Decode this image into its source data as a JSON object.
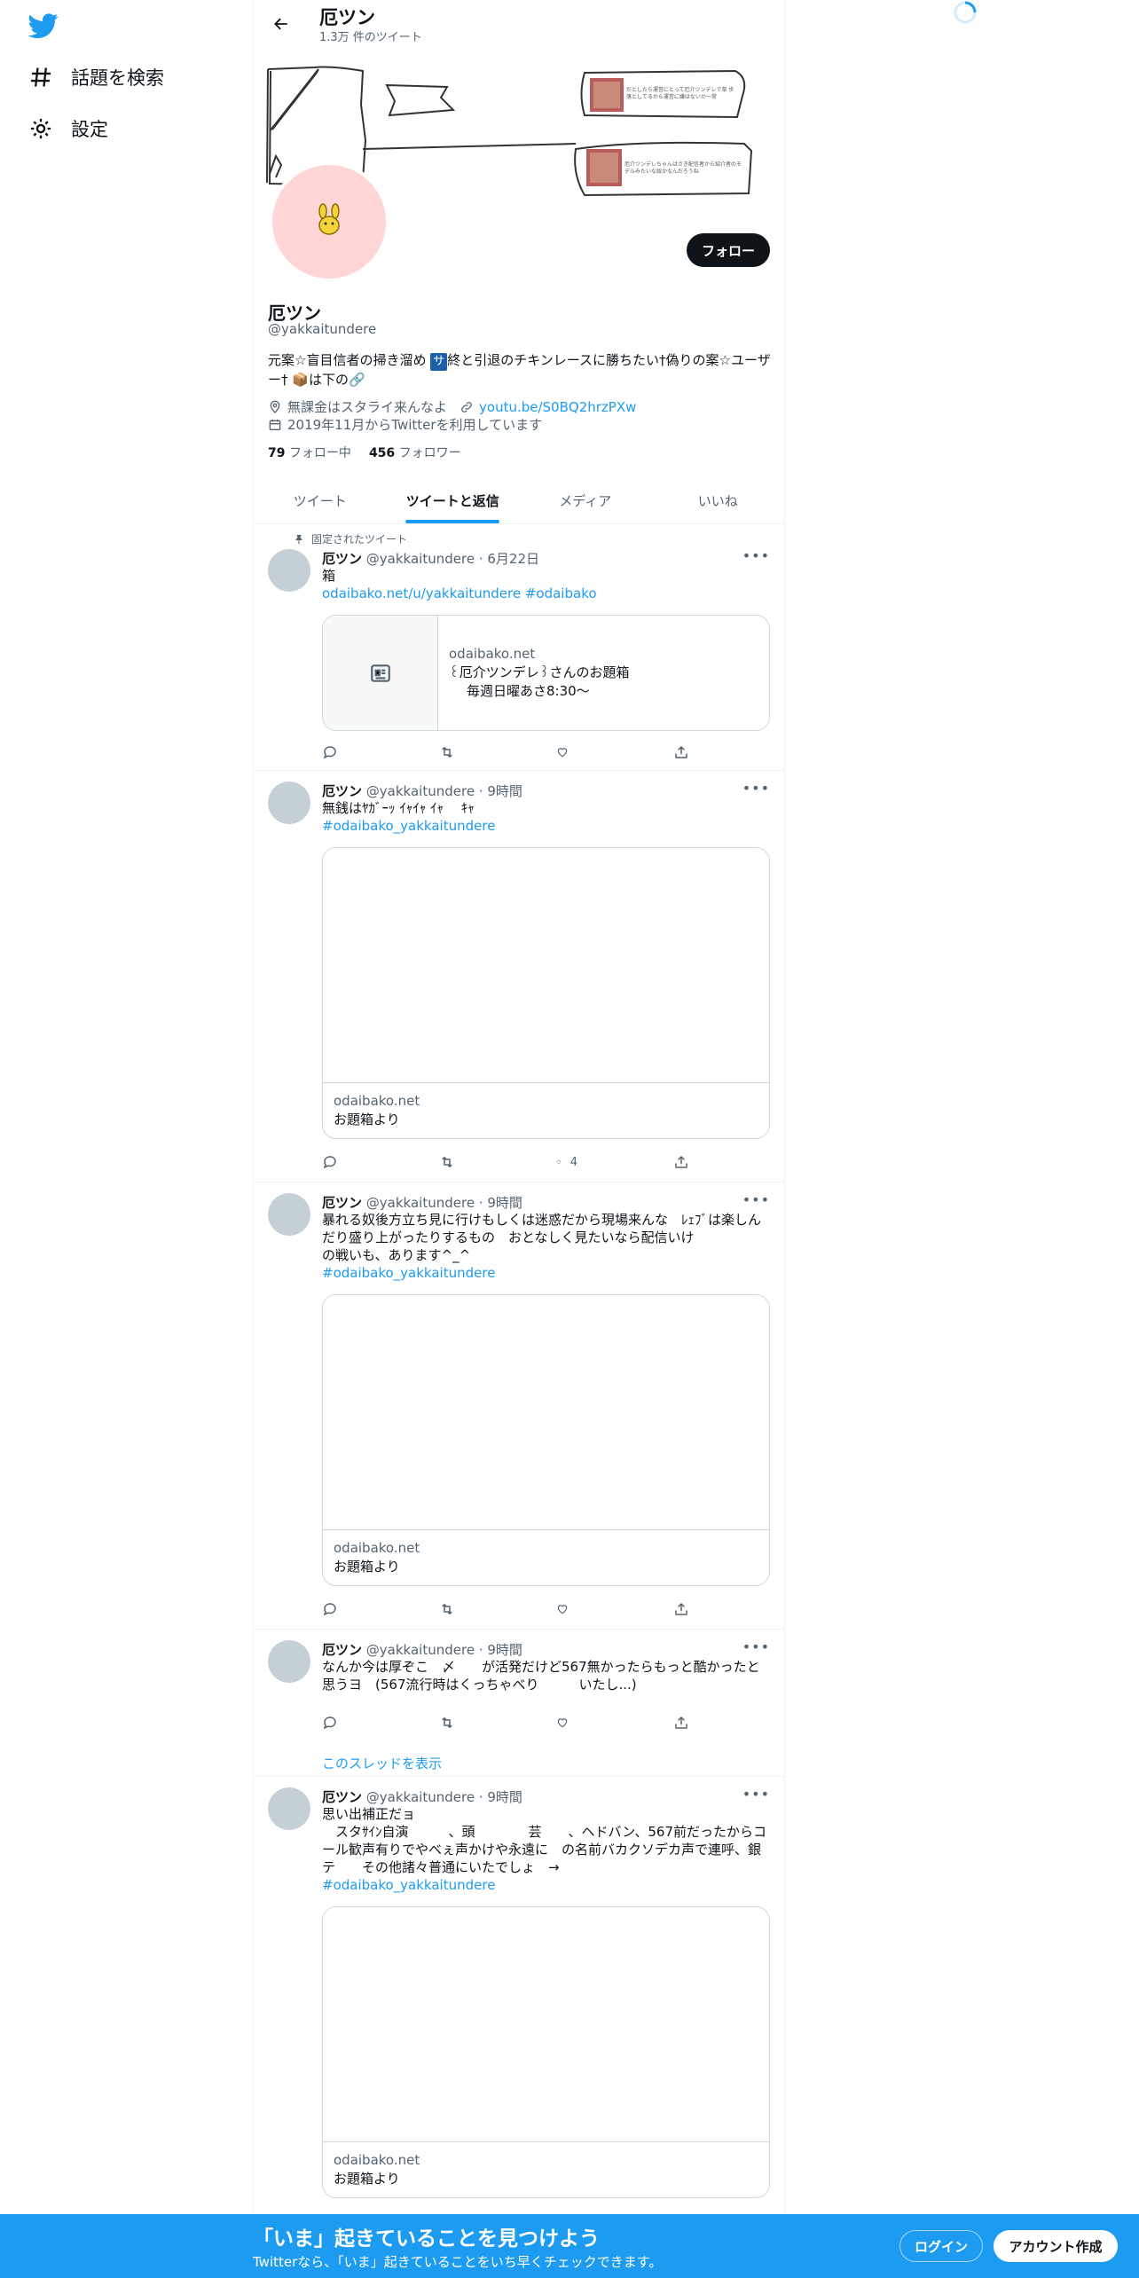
{
  "colors": {
    "accent": "#1d9bf0",
    "text": "#0f1419",
    "muted": "#536471",
    "border": "#eff3f4",
    "avatar_bg": "#ffd5d5"
  },
  "sidebar": {
    "logo_icon": "twitter-bird-icon",
    "items": [
      {
        "label": "話題を検索",
        "icon": "hashtag-icon"
      },
      {
        "label": "設定",
        "icon": "gear-icon"
      }
    ]
  },
  "header": {
    "title": "厄ツン",
    "subtitle": "1.3万 件のツイート"
  },
  "banner": {
    "note1": "だとしたら運営にとって厄介ツンデレで草 歩落としてるから運営に嫌はないか一常",
    "note2": "厄介ツンデレちゃんはさき配信者から紹介者のモデルみたいな奴かなんだろうね"
  },
  "profile": {
    "follow_label": "フォロー",
    "name": "厄ツン",
    "handle": "@yakkaitundere",
    "bio_1": "元案☆盲目信者の掃き溜め ",
    "bio_box": "サ",
    "bio_2": "終と引退のチキンレースに勝ちたい†偽りの案☆ユーザー† 📦は下の🔗",
    "location": "無課金はスタライ来んなよ",
    "website": "youtu.be/S0BQ2hrzPXw",
    "joined": "2019年11月からTwitterを利用しています",
    "following_count": "79",
    "following_label": "フォロー中",
    "followers_count": "456",
    "followers_label": "フォロワー"
  },
  "tabs": [
    "ツイート",
    "ツイートと返信",
    "メディア",
    "いいね"
  ],
  "active_tab": "ツイートと返信",
  "tweets": [
    {
      "pinned_label": "固定されたツイート",
      "name": "厄ツン",
      "handle": "@yakkaitundere",
      "time": "6月22日",
      "text": "箱",
      "link": "odaibako.net/u/yakkaitundere #odaibako",
      "card": {
        "domain": "odaibako.net",
        "title": "꒰厄介ツンデレ꒱さんのお題箱",
        "desc": "毎週日曜あさ8:30〜"
      },
      "likes": ""
    },
    {
      "name": "厄ツン",
      "handle": "@yakkaitundere",
      "time": "9時間",
      "text": "無銭はﾔｶﾞｰｯ ｲｬｲｬ ｲｬ　 ｷｬ",
      "link": "#odaibako_yakkaitundere",
      "card": {
        "domain": "odaibako.net",
        "title": "お題箱より"
      },
      "likes": "4"
    },
    {
      "name": "厄ツン",
      "handle": "@yakkaitundere",
      "time": "9時間",
      "text": "暴れる奴後方立ち見に行けもしくは迷惑だから現場来んな　ﾚｪﾌﾞは楽しんだり盛り上がったりするもの　おとなしく見たいなら配信いけ\nの戦いも、あります^_^",
      "link": "#odaibako_yakkaitundere",
      "card": {
        "domain": "odaibako.net",
        "title": "お題箱より"
      },
      "likes": ""
    },
    {
      "name": "厄ツン",
      "handle": "@yakkaitundere",
      "time": "9時間",
      "text": "なんか今は厚ぞこ　〆　　が活発だけど567無かったらもっと酷かったと思うヨ　(567流行時はくっちゃべり　　　いたし...)",
      "thread_label": "このスレッドを表示",
      "likes": ""
    },
    {
      "name": "厄ツン",
      "handle": "@yakkaitundere",
      "time": "9時間",
      "text": "思い出補正だョ\n　スタｻｲﾝ自演　　　、頭　　　　芸　　、ヘドバン、567前だったからコール歓声有りでやべぇ声かけや永遠に　の名前バカクソデカ声で連呼、銀テ　　その他諸々普通にいたでしょ　→",
      "link": "#odaibako_yakkaitundere",
      "card": {
        "domain": "odaibako.net",
        "title": "お題箱より"
      },
      "likes": ""
    }
  ],
  "bottom_bar": {
    "title": "「いま」起きていることを見つけよう",
    "subtitle": "Twitterなら、「いま」起きていることをいち早くチェックできます。",
    "login": "ログイン",
    "signup": "アカウント作成"
  }
}
